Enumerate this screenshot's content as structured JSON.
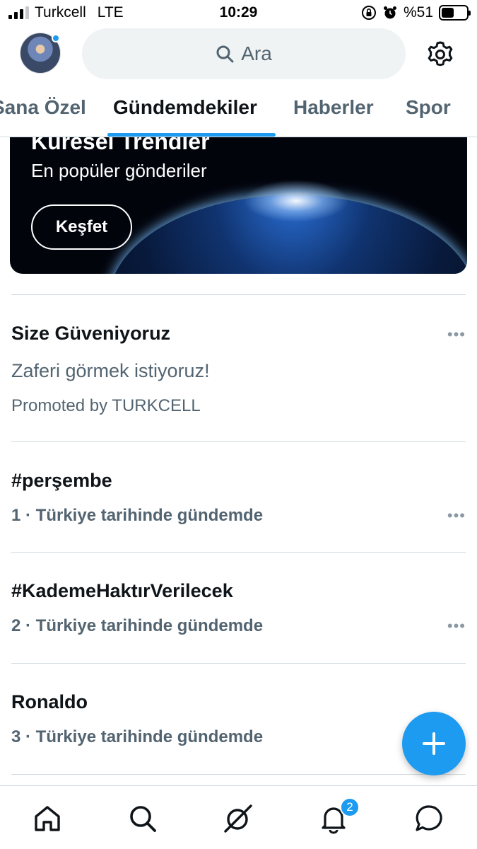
{
  "status_bar": {
    "carrier": "Turkcell",
    "network": "LTE",
    "time": "10:29",
    "battery": "%51",
    "battery_level": 0.51
  },
  "header": {
    "search_placeholder": "Ara"
  },
  "tabs": [
    {
      "label": "Sana Özel",
      "active": false
    },
    {
      "label": "Gündemdekiler",
      "active": true
    },
    {
      "label": "Haberler",
      "active": false
    },
    {
      "label": "Spor",
      "active": false
    }
  ],
  "banner": {
    "title": "Küresel Trendler",
    "subtitle": "En popüler gönderiler",
    "button": "Keşfet"
  },
  "promoted": {
    "title": "Size Güveniyoruz",
    "subtitle": "Zaferi görmek istiyoruz!",
    "by": "Promoted by TURKCELL"
  },
  "trends": [
    {
      "name": "#perşembe",
      "meta": "1 · Türkiye tarihinde gündemde"
    },
    {
      "name": "#KademeHaktırVerilecek",
      "meta": "2 · Türkiye tarihinde gündemde"
    },
    {
      "name": "Ronaldo",
      "meta": "3 · Türkiye tarihinde gündemde"
    }
  ],
  "more_glyph": "•••",
  "nav": {
    "notifications_badge": "2",
    "items": [
      "home-icon",
      "search-icon",
      "grok-icon",
      "bell-icon",
      "messages-icon"
    ]
  },
  "colors": {
    "accent": "#1d9bf0",
    "text": "#0f1419",
    "muted": "#536471"
  }
}
